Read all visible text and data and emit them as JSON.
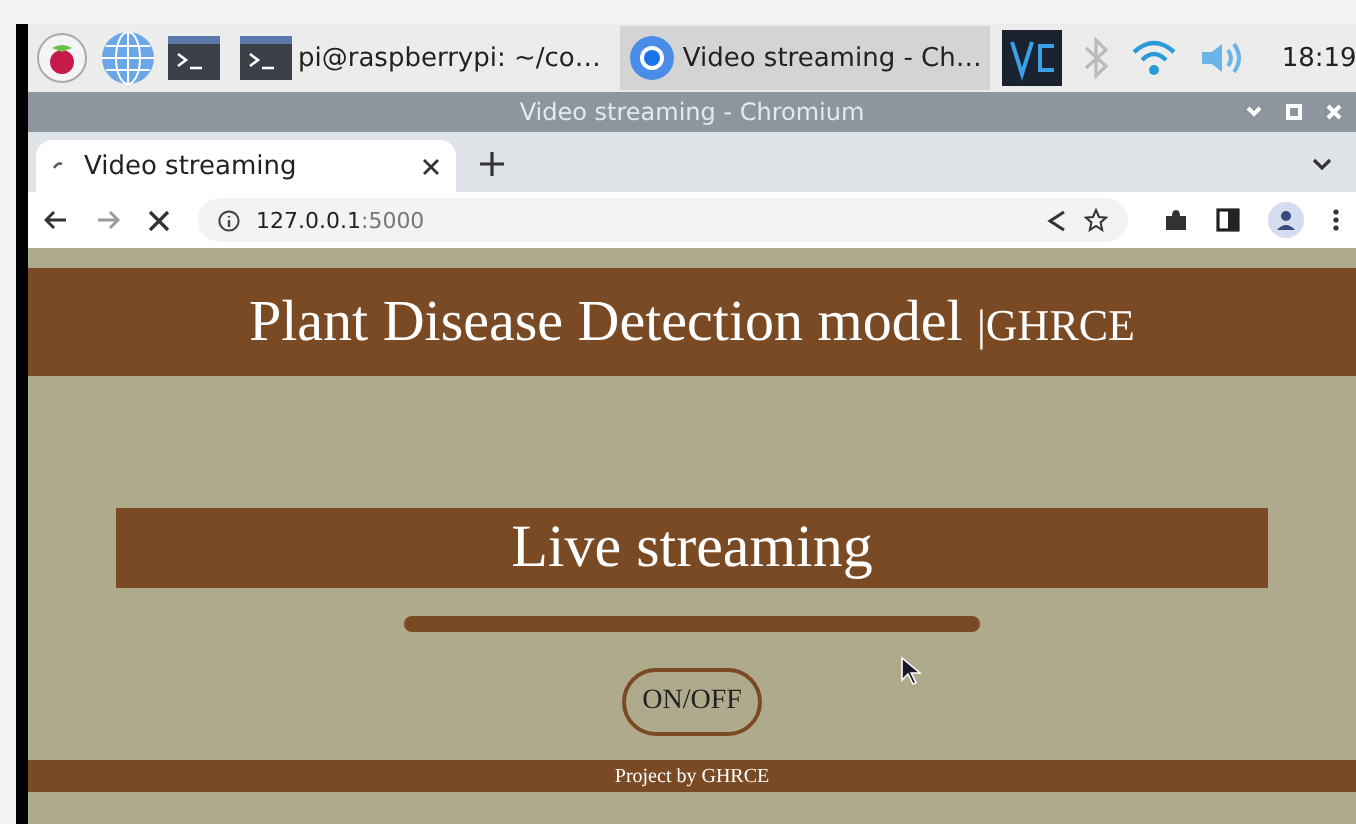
{
  "taskbar": {
    "windows": [
      {
        "label": "pi@raspberrypi: ~/co…",
        "kind": "terminal",
        "selected": false
      },
      {
        "label": "Video streaming - Ch…",
        "kind": "browser",
        "selected": true
      }
    ],
    "clock": "18:19"
  },
  "window": {
    "title": "Video streaming - Chromium"
  },
  "tabs": [
    {
      "label": "Video streaming",
      "selected": true
    }
  ],
  "address": {
    "host": "127.0.0.1",
    "port": ":5000"
  },
  "page": {
    "title": "Plant Disease Detection model",
    "title_suffix": "|GHRCE",
    "banner": "Live streaming",
    "button": "ON/OFF",
    "footer": "Project by GHRCE"
  }
}
